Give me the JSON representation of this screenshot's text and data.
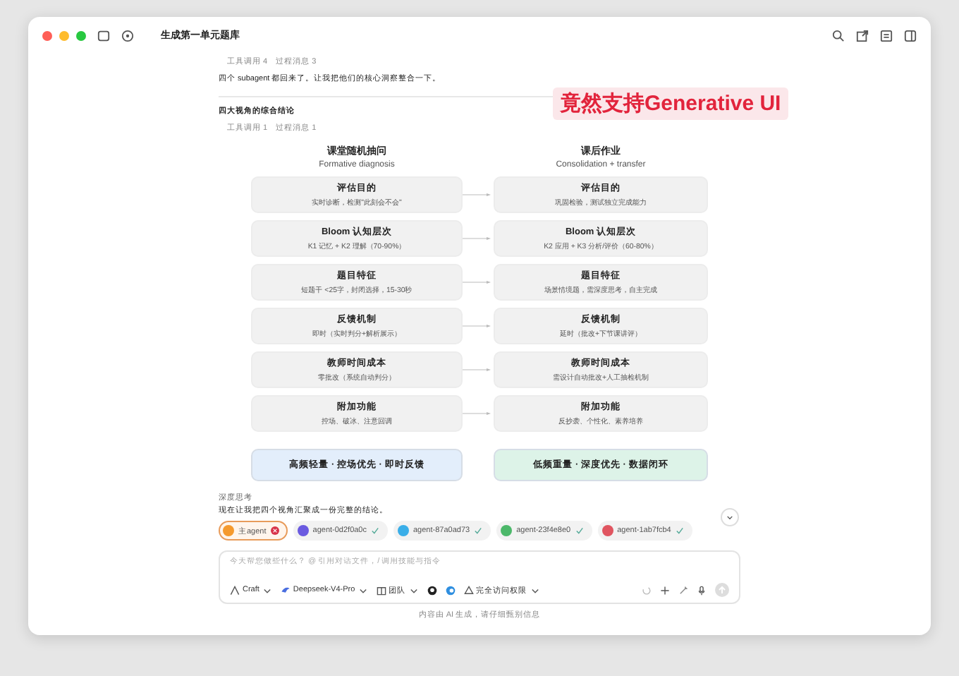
{
  "window": {
    "title": "生成第一单元题库"
  },
  "annotation": "竟然支持Generative UI",
  "blocks": [
    {
      "kind": "steps",
      "items": [
        "工具调用 4",
        "过程消息 3"
      ]
    },
    {
      "kind": "text",
      "text": "四个 subagent 都回来了。让我把他们的核心洞察整合一下。"
    },
    {
      "kind": "divider"
    },
    {
      "kind": "heading",
      "text": "四大视角的综合结论"
    },
    {
      "kind": "steps",
      "items": [
        "工具调用 1",
        "过程消息 1"
      ]
    }
  ],
  "comparison": {
    "columns": [
      {
        "title": "课堂随机抽问",
        "subtitle": "Formative diagnosis"
      },
      {
        "title": "课后作业",
        "subtitle": "Consolidation + transfer"
      }
    ],
    "rows": [
      {
        "left": {
          "title": "评估目的",
          "detail": "实时诊断，检测\"此刻会不会\""
        },
        "right": {
          "title": "评估目的",
          "detail": "巩固检验，测试独立完成能力"
        }
      },
      {
        "left": {
          "title": "Bloom 认知层次",
          "detail": "K1 记忆 + K2 理解（70-90%）"
        },
        "right": {
          "title": "Bloom 认知层次",
          "detail": "K2 应用 + K3 分析/评价（60-80%）"
        }
      },
      {
        "left": {
          "title": "题目特征",
          "detail": "短题干 <25字，封闭选择，15-30秒"
        },
        "right": {
          "title": "题目特征",
          "detail": "场景情境题，需深度思考，自主完成"
        }
      },
      {
        "left": {
          "title": "反馈机制",
          "detail": "即时（实时判分+解析展示）"
        },
        "right": {
          "title": "反馈机制",
          "detail": "延时（批改+下节课讲评）"
        }
      },
      {
        "left": {
          "title": "教师时间成本",
          "detail": "零批改（系统自动判分）"
        },
        "right": {
          "title": "教师时间成本",
          "detail": "需设计自动批改+人工抽检机制"
        }
      },
      {
        "left": {
          "title": "附加功能",
          "detail": "控场、破冰、注意回调"
        },
        "right": {
          "title": "附加功能",
          "detail": "反抄袭、个性化、素养培养"
        }
      }
    ],
    "summaries": [
      {
        "text": "高频轻量 · 控场优先 · 即时反馈",
        "color": "#e3eefb"
      },
      {
        "text": "低频重量 · 深度优先 · 数据闭环",
        "color": "#ddf3e8"
      }
    ]
  },
  "thinking": {
    "label": "深度思考",
    "text": "现在让我把四个视角汇聚成一份完整的结论。"
  },
  "agents": [
    {
      "label": "主agent",
      "color": "#f59a2e",
      "error": true,
      "selected": true
    },
    {
      "label": "agent-0d2f0a0c",
      "color": "#6a5ae0",
      "error": false,
      "selected": false
    },
    {
      "label": "agent-87a0ad73",
      "color": "#3aaee8",
      "error": false,
      "selected": false
    },
    {
      "label": "agent-23f4e8e0",
      "color": "#4cb86a",
      "error": false,
      "selected": false
    },
    {
      "label": "agent-1ab7fcb4",
      "color": "#e05560",
      "error": false,
      "selected": false
    }
  ],
  "composer": {
    "placeholder": "今天帮您做些什么？ @ 引用对话文件，/ 调用技能与指令",
    "mode": "Craft",
    "model": "Deepseek-V4-Pro",
    "book": "团队",
    "access": "完全访问权限"
  },
  "footer": "内容由 AI 生成，请仔细甄别信息"
}
